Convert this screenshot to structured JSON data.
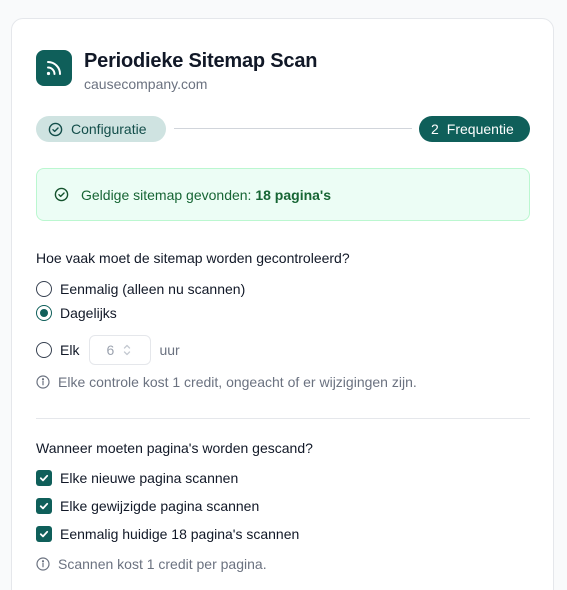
{
  "header": {
    "title": "Periodieke Sitemap Scan",
    "subtitle": "causecompany.com",
    "icon": "rss-icon"
  },
  "steps": [
    {
      "label": "Configuratie",
      "state": "completed",
      "icon": "check-circle-icon"
    },
    {
      "number": "2",
      "label": "Frequentie",
      "state": "active"
    }
  ],
  "alert": {
    "text": "Geldige sitemap gevonden: ",
    "highlight": "18 pagina's",
    "icon": "check-circle-icon"
  },
  "frequency": {
    "question": "Hoe vaak moet de sitemap worden gecontroleerd?",
    "options": [
      {
        "label": "Eenmalig (alleen nu scannen)",
        "selected": false
      },
      {
        "label": "Dagelijks",
        "selected": true
      },
      {
        "label": "Elk",
        "selected": false
      }
    ],
    "interval_value": "6",
    "interval_unit": "uur",
    "hint": "Elke controle kost 1 credit, ongeacht of er wijzigingen zijn."
  },
  "pages": {
    "question": "Wanneer moeten pagina's worden gescand?",
    "options": [
      {
        "label": "Elke nieuwe pagina scannen",
        "checked": true
      },
      {
        "label": "Elke gewijzigde pagina scannen",
        "checked": true
      },
      {
        "label": "Eenmalig huidige 18 pagina's scannen",
        "checked": true
      }
    ],
    "hint": "Scannen kost 1 credit per pagina."
  },
  "colors": {
    "accent": "#0f5f5a",
    "success_bg": "#ecfdf5",
    "success_text": "#166534"
  }
}
